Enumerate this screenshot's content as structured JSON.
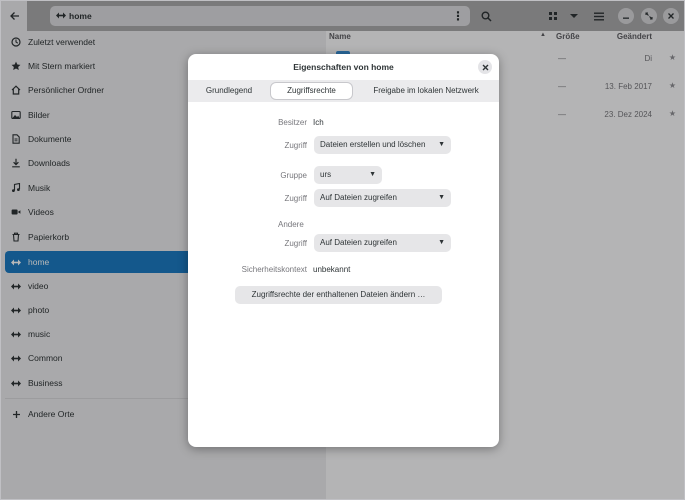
{
  "header": {
    "location_label": "home"
  },
  "sidebar": {
    "items": [
      {
        "icon": "clock-icon",
        "label": "Zuletzt verwendet"
      },
      {
        "icon": "star-icon",
        "label": "Mit Stern markiert"
      },
      {
        "icon": "home-icon",
        "label": "Persönlicher Ordner"
      },
      {
        "icon": "picture-icon",
        "label": "Bilder"
      },
      {
        "icon": "document-icon",
        "label": "Dokumente"
      },
      {
        "icon": "download-icon",
        "label": "Downloads"
      },
      {
        "icon": "music-icon",
        "label": "Musik"
      },
      {
        "icon": "video-icon",
        "label": "Videos"
      },
      {
        "icon": "trash-icon",
        "label": "Papierkorb"
      },
      {
        "icon": "network-folder-icon",
        "label": "home"
      },
      {
        "icon": "network-folder-icon",
        "label": "video"
      },
      {
        "icon": "network-folder-icon",
        "label": "photo"
      },
      {
        "icon": "network-folder-icon",
        "label": "music"
      },
      {
        "icon": "network-folder-icon",
        "label": "Common"
      },
      {
        "icon": "network-folder-icon",
        "label": "Business"
      }
    ],
    "other_places": {
      "icon": "plus-icon",
      "label": "Andere Orte"
    }
  },
  "file_list": {
    "columns": {
      "name": "Name",
      "size": "Größe",
      "modified": "Geändert"
    },
    "rows": [
      {
        "size": "—",
        "modified": "Di"
      },
      {
        "size": "—",
        "modified": "13. Feb 2017"
      },
      {
        "size": "—",
        "modified": "23. Dez 2024"
      }
    ]
  },
  "dialog": {
    "title": "Eigenschaften von home",
    "tabs": [
      "Grundlegend",
      "Zugriffsrechte",
      "Freigabe im lokalen Netzwerk"
    ],
    "owner_label": "Besitzer",
    "owner_value": "Ich",
    "owner_access_label": "Zugriff",
    "owner_access_value": "Dateien erstellen und löschen",
    "group_label": "Gruppe",
    "group_value": "urs",
    "group_access_label": "Zugriff",
    "group_access_value": "Auf Dateien zugreifen",
    "others_label": "Andere",
    "others_access_label": "Zugriff",
    "others_access_value": "Auf Dateien zugreifen",
    "security_context_label": "Sicherheitskontext",
    "security_context_value": "unbekannt",
    "change_button_label": "Zugriffsrechte der enthaltenen Dateien ändern …"
  }
}
